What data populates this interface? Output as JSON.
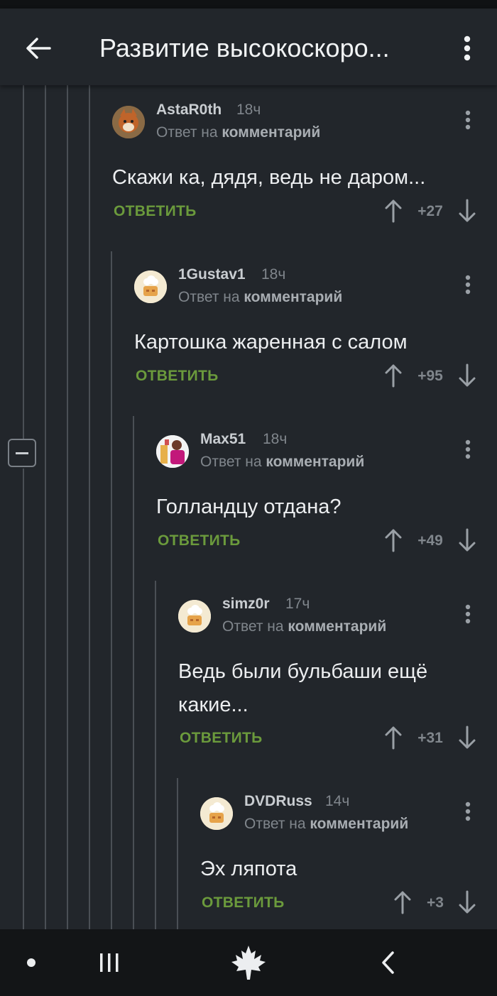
{
  "header": {
    "title": "Развитие высокоскоро...",
    "back_icon": "arrow-left-icon",
    "menu_icon": "more-vertical-icon"
  },
  "labels": {
    "reply": "ОТВЕТИТЬ",
    "reply_to_prefix": "Ответ на ",
    "reply_to_target": "комментарий"
  },
  "comments": [
    {
      "author": "AstaR0th",
      "time": "18ч",
      "text": "Скажи ка, дядя, ведь не даром...",
      "score": "+27"
    },
    {
      "author": "1Gustav1",
      "time": "18ч",
      "text": "Картошка жаренная с салом",
      "score": "+95"
    },
    {
      "author": "Max51",
      "time": "18ч",
      "text": "Голландцу отдана?",
      "score": "+49"
    },
    {
      "author": "simz0r",
      "time": "17ч",
      "text_line1": "Ведь были бульбаши ещё",
      "text_line2": "какие...",
      "score": "+31"
    },
    {
      "author": "DVDRuss",
      "time": "14ч",
      "text": "Эх ляпота",
      "score": "+3"
    }
  ],
  "colors": {
    "background": "#22262b",
    "reply_button": "#6b9a3c",
    "thread_line": "#4a4f55"
  },
  "navbar": {
    "icons": [
      "dot-icon",
      "recent-apps-icon",
      "maple-leaf-icon",
      "back-chevron-icon"
    ]
  }
}
